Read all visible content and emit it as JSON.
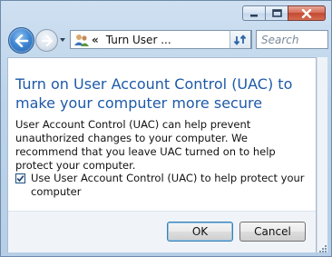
{
  "window": {
    "caption": {
      "minimize": "minimize-icon",
      "maximize": "maximize-icon",
      "close": "close-icon"
    }
  },
  "nav": {
    "address_chevron": "«",
    "address_text": "Turn User ...",
    "search_placeholder": "Search"
  },
  "dialog": {
    "heading": "Turn on User Account Control (UAC) to make your computer more secure",
    "description": "User Account Control (UAC) can help prevent unauthorized changes to your computer.  We recommend that you leave UAC turned on to help protect your computer.",
    "checkbox_label": "Use User Account Control (UAC) to help protect your computer",
    "checkbox_checked": true,
    "ok_label": "OK",
    "cancel_label": "Cancel"
  },
  "colors": {
    "heading": "#1e5aa8",
    "frame": "#bcd3ea",
    "close_button": "#c24a32"
  }
}
